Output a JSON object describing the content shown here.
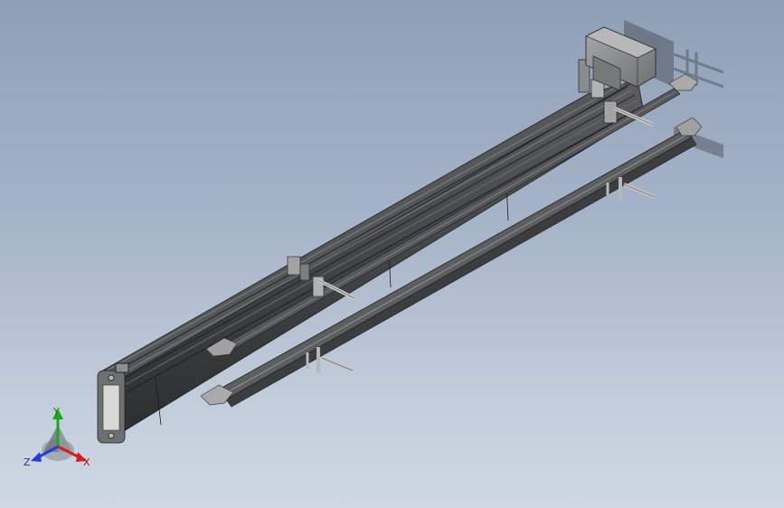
{
  "triad": {
    "y_label": "Y",
    "z_label": "Z",
    "x_label": "X"
  },
  "colors": {
    "background_top": "#8f9fb6",
    "background_bottom": "#cfd8e4",
    "body_dark": "#2d2f30",
    "body_mid": "#4c4e4f",
    "body_light": "#7a7c7d",
    "steel": "#9a9b9c",
    "motor": "#8e8f90",
    "axis_x": "#d62020",
    "axis_y": "#1fa51f",
    "axis_z": "#2040d8"
  }
}
